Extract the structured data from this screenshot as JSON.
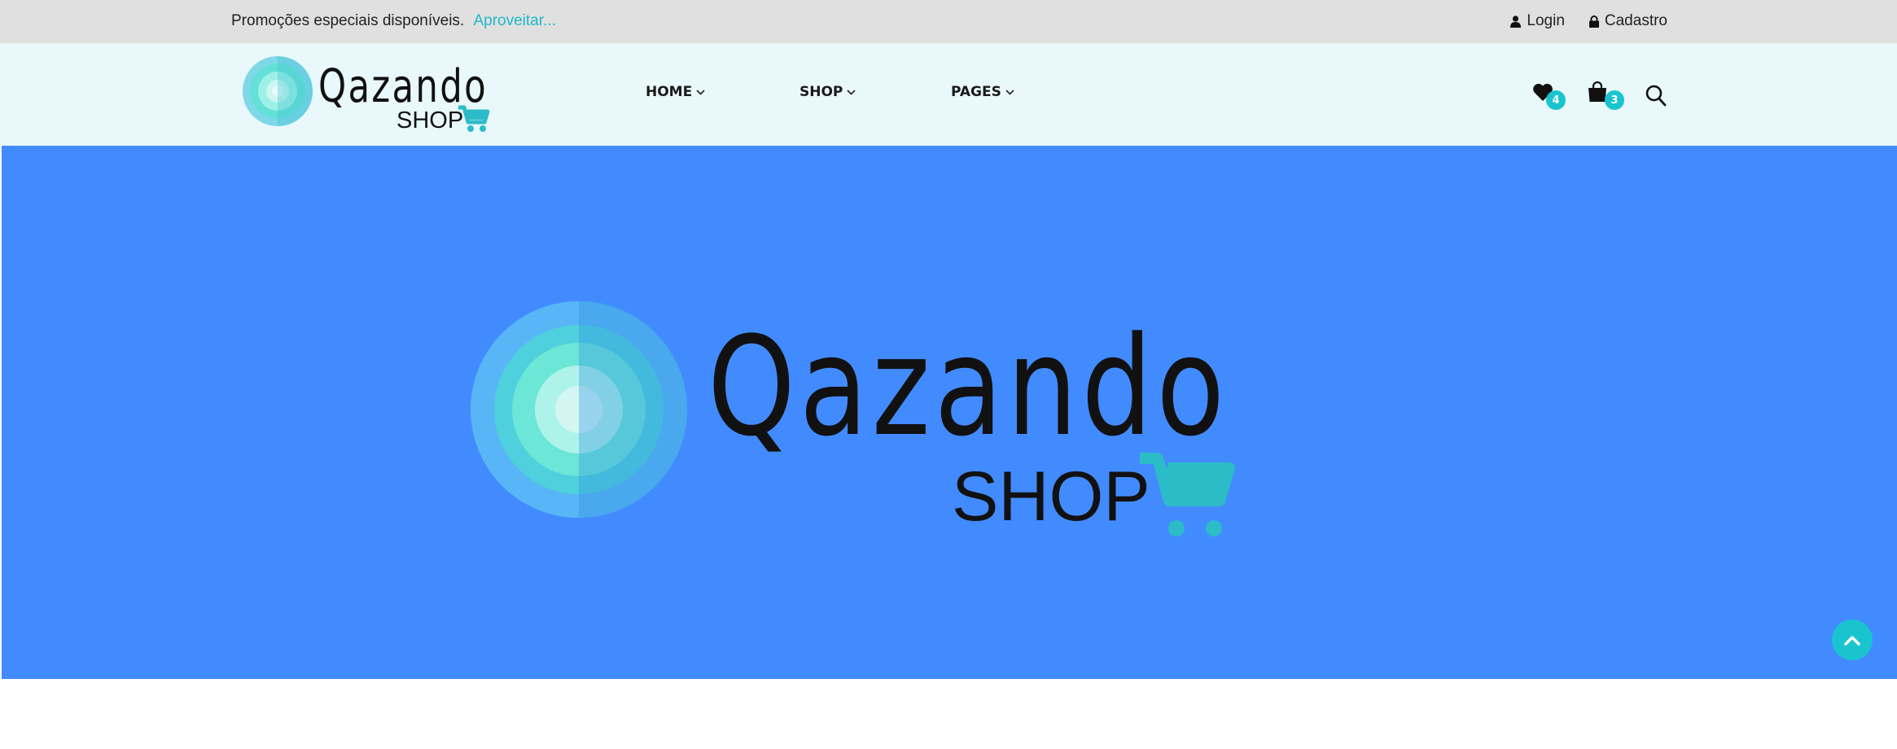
{
  "topbar": {
    "promo_text": "Promoções especiais disponíveis.",
    "promo_link": "Aproveitar...",
    "login_label": "Login",
    "register_label": "Cadastro"
  },
  "brand": {
    "name": "Qazando",
    "sub": "SHOP",
    "colors": {
      "topbar_bg": "#e0e0e0",
      "header_bg": "#e9f8fa",
      "hero_bg": "#428bff",
      "accent": "#19c4cf"
    }
  },
  "nav": {
    "items": [
      {
        "label": "HOME"
      },
      {
        "label": "SHOP"
      },
      {
        "label": "PAGES"
      }
    ]
  },
  "header_icons": {
    "wishlist_count": "4",
    "cart_count": "3",
    "wishlist_icon": "heart-icon",
    "cart_icon": "shopping-bag-icon",
    "search_icon": "search-icon"
  }
}
